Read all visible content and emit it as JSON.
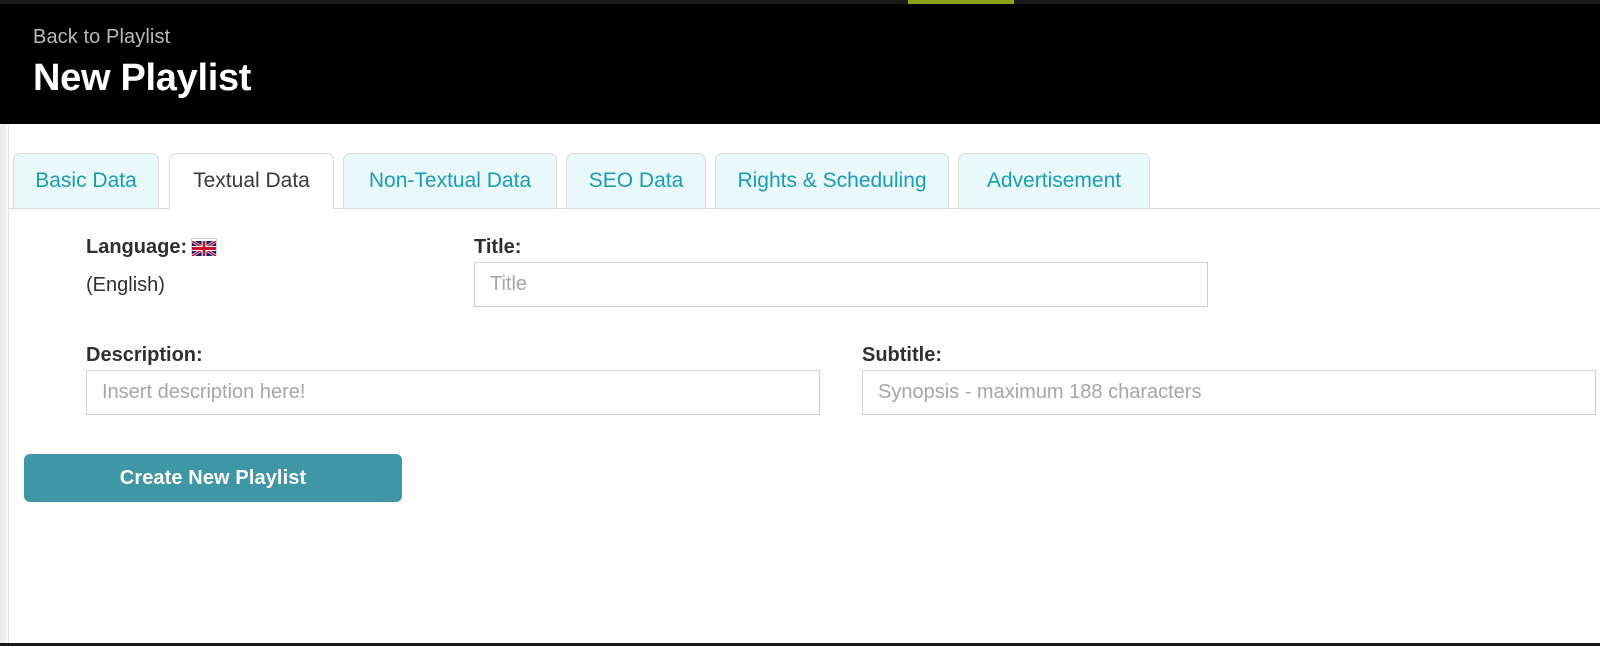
{
  "header": {
    "back_label": "Back to Playlist",
    "title": "New Playlist"
  },
  "accent": {
    "progress_color": "#8ba319",
    "bar_background": "#1a1a1a"
  },
  "tabs": {
    "active_index": 1,
    "items": [
      {
        "label": "Basic Data"
      },
      {
        "label": "Textual Data"
      },
      {
        "label": "Non-Textual Data"
      },
      {
        "label": "SEO Data"
      },
      {
        "label": "Rights & Scheduling"
      },
      {
        "label": "Advertisement"
      }
    ]
  },
  "form": {
    "language": {
      "label": "Language:",
      "icon": "uk-flag-icon",
      "value": "(English)"
    },
    "title": {
      "label": "Title:",
      "placeholder": "Title",
      "value": ""
    },
    "description": {
      "label": "Description:",
      "placeholder": "Insert description here!",
      "value": ""
    },
    "subtitle": {
      "label": "Subtitle:",
      "placeholder": "Synopsis - maximum 188 characters",
      "value": ""
    },
    "submit": {
      "label": "Create New Playlist",
      "color": "#3f96a4"
    }
  },
  "colors": {
    "tab_active_text": "#3a3a3a",
    "tab_inactive_text": "#1a9cb8",
    "tab_inactive_bg": "#e9f8f8",
    "header_bg": "#000000",
    "back_link": "#b9b9b9"
  }
}
